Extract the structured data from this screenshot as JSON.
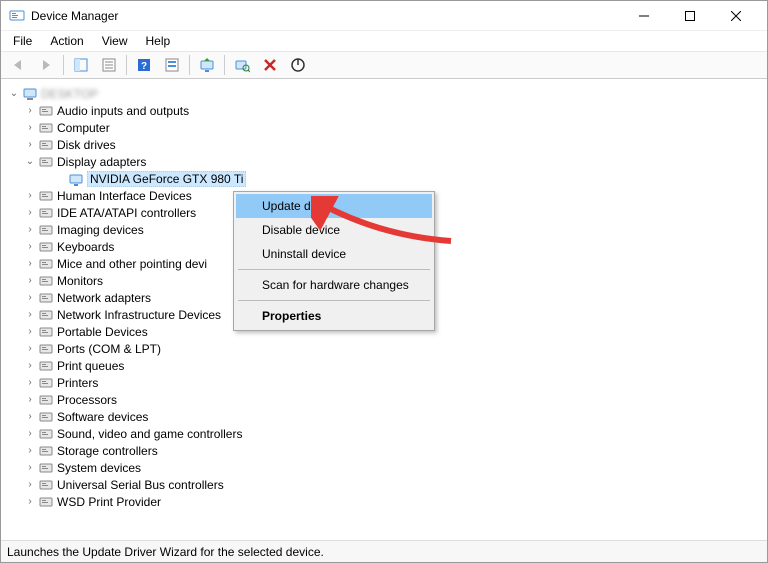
{
  "window": {
    "title": "Device Manager"
  },
  "menu": {
    "file": "File",
    "action": "Action",
    "view": "View",
    "help": "Help"
  },
  "tree": {
    "root": "",
    "items": [
      {
        "label": "Audio inputs and outputs"
      },
      {
        "label": "Computer"
      },
      {
        "label": "Disk drives"
      },
      {
        "label": "Display adapters",
        "expanded": true,
        "children": [
          {
            "label": "NVIDIA GeForce GTX 980 Ti",
            "selected": true
          }
        ]
      },
      {
        "label": "Human Interface Devices"
      },
      {
        "label": "IDE ATA/ATAPI controllers"
      },
      {
        "label": "Imaging devices"
      },
      {
        "label": "Keyboards"
      },
      {
        "label": "Mice and other pointing devi"
      },
      {
        "label": "Monitors"
      },
      {
        "label": "Network adapters"
      },
      {
        "label": "Network Infrastructure Devices"
      },
      {
        "label": "Portable Devices"
      },
      {
        "label": "Ports (COM & LPT)"
      },
      {
        "label": "Print queues"
      },
      {
        "label": "Printers"
      },
      {
        "label": "Processors"
      },
      {
        "label": "Software devices"
      },
      {
        "label": "Sound, video and game controllers"
      },
      {
        "label": "Storage controllers"
      },
      {
        "label": "System devices"
      },
      {
        "label": "Universal Serial Bus controllers"
      },
      {
        "label": "WSD Print Provider"
      }
    ]
  },
  "contextmenu": {
    "update": "Update driver",
    "disable": "Disable device",
    "uninstall": "Uninstall device",
    "scan": "Scan for hardware changes",
    "properties": "Properties"
  },
  "statusbar": {
    "text": "Launches the Update Driver Wizard for the selected device."
  }
}
